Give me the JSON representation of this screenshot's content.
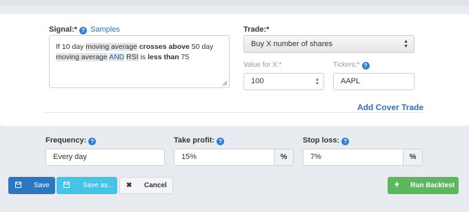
{
  "signal": {
    "label": "Signal:",
    "required_mark": "*",
    "help": "?",
    "samples_link": "Samples",
    "text": {
      "p1": "If 10 day ",
      "p2": "moving average",
      "p3": " ",
      "p4": "crosses above",
      "p5": " 50 day",
      "p6": "moving average",
      "p7": " ",
      "p8": "AND",
      "p9": " ",
      "p10": "RSI",
      "p11": " is ",
      "p12": "less than",
      "p13": " 75"
    }
  },
  "trade": {
    "label": "Trade:",
    "required_mark": "*",
    "selected": "Buy X number of shares",
    "value_label": "Value for X:*",
    "value": "100",
    "tickers_label": "Tickers:*",
    "tickers_help": "?",
    "tickers_value": "AAPL"
  },
  "cover_trade_link": "Add Cover Trade",
  "frequency": {
    "label": "Frequency:",
    "help": "?",
    "value": "Every day"
  },
  "take_profit": {
    "label": "Take profit:",
    "help": "?",
    "value": "15%",
    "unit": "%"
  },
  "stop_loss": {
    "label": "Stop loss:",
    "help": "?",
    "value": "7%",
    "unit": "%"
  },
  "buttons": {
    "save": "Save",
    "save_as": "Save as...",
    "cancel": "Cancel",
    "run": "Run Backtest"
  },
  "colors": {
    "primary": "#2a78c2",
    "save_as": "#45c4ea",
    "run": "#5cb85c",
    "link": "#2f6fbd"
  }
}
